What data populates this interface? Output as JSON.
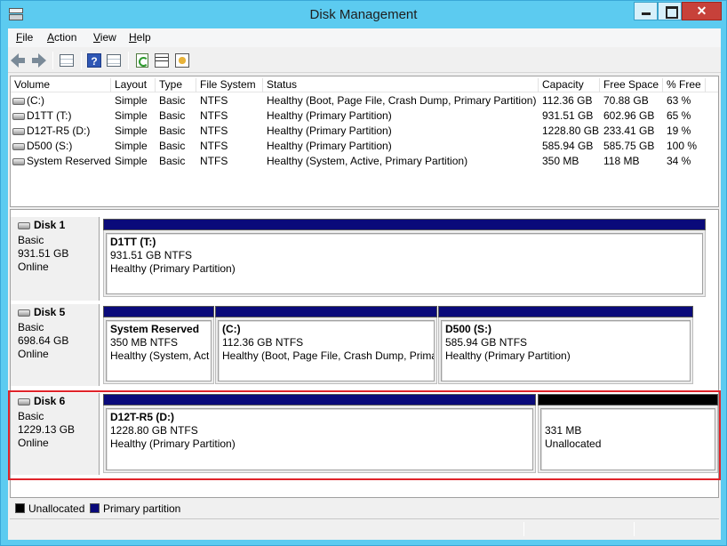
{
  "window": {
    "title": "Disk Management"
  },
  "menu": [
    {
      "pre": "",
      "u": "F",
      "post": "ile"
    },
    {
      "pre": "",
      "u": "A",
      "post": "ction"
    },
    {
      "pre": "",
      "u": "V",
      "post": "iew"
    },
    {
      "pre": "",
      "u": "H",
      "post": "elp"
    }
  ],
  "toolbar_icons": [
    "back-arrow-icon",
    "forward-arrow-icon",
    "volume-list-icon",
    "help-icon",
    "disk-list-icon",
    "refresh-icon",
    "properties-icon",
    "settings-icon"
  ],
  "volume_list": {
    "columns": [
      "Volume",
      "Layout",
      "Type",
      "File System",
      "Status",
      "Capacity",
      "Free Space",
      "% Free"
    ],
    "rows": [
      [
        "(C:)",
        "Simple",
        "Basic",
        "NTFS",
        "Healthy (Boot, Page File, Crash Dump, Primary Partition)",
        "112.36 GB",
        "70.88 GB",
        "63 %"
      ],
      [
        "D1TT (T:)",
        "Simple",
        "Basic",
        "NTFS",
        "Healthy (Primary Partition)",
        "931.51 GB",
        "602.96 GB",
        "65 %"
      ],
      [
        "D12T-R5 (D:)",
        "Simple",
        "Basic",
        "NTFS",
        "Healthy (Primary Partition)",
        "1228.80 GB",
        "233.41 GB",
        "19 %"
      ],
      [
        "D500 (S:)",
        "Simple",
        "Basic",
        "NTFS",
        "Healthy (Primary Partition)",
        "585.94 GB",
        "585.75 GB",
        "100 %"
      ],
      [
        "System Reserved",
        "Simple",
        "Basic",
        "NTFS",
        "Healthy (System, Active, Primary Partition)",
        "350 MB",
        "118 MB",
        "34 %"
      ]
    ]
  },
  "disks": [
    {
      "name": "Disk 1",
      "type": "Basic",
      "size": "931.51 GB",
      "status": "Online",
      "partitions": [
        {
          "label": "D1TT  (T:)",
          "size": "931.51 GB NTFS",
          "status": "Healthy (Primary Partition)"
        }
      ]
    },
    {
      "name": "Disk 5",
      "type": "Basic",
      "size": "698.64 GB",
      "status": "Online",
      "partitions": [
        {
          "label": "System Reserved",
          "size": "350 MB NTFS",
          "status": "Healthy (System, Act"
        },
        {
          "label": "(C:)",
          "size": "112.36 GB NTFS",
          "status": "Healthy (Boot, Page File, Crash Dump, Prima"
        },
        {
          "label": "D500  (S:)",
          "size": "585.94 GB NTFS",
          "status": "Healthy (Primary Partition)"
        }
      ]
    },
    {
      "name": "Disk 6",
      "type": "Basic",
      "size": "1229.13 GB",
      "status": "Online",
      "partitions": [
        {
          "label": "D12T-R5  (D:)",
          "size": "1228.80 GB NTFS",
          "status": "Healthy (Primary Partition)"
        },
        {
          "label": "",
          "size": "331 MB",
          "status": "Unallocated"
        }
      ]
    }
  ],
  "legend": [
    {
      "label": "Unallocated",
      "color": "#000000"
    },
    {
      "label": "Primary partition",
      "color": "#0a0a7a"
    }
  ],
  "colors": {
    "primary_partition": "#0a0a7a",
    "unallocated": "#000000",
    "highlight": "#e0242a",
    "window_frame": "#5ccbf0"
  }
}
